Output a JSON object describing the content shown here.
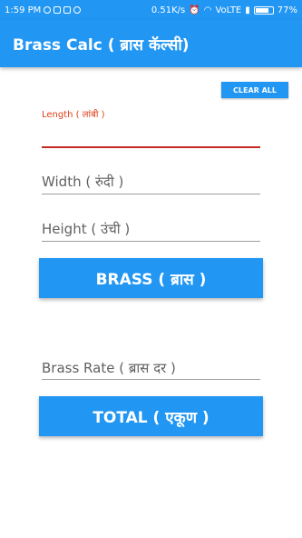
{
  "status_bar": {
    "time": "1:59 PM",
    "speed": "0.51K/s",
    "network": "VoLTE",
    "battery": "77%",
    "battery_level": 0.77
  },
  "app_bar": {
    "title": "Brass Calc ( ब्रास कॅल्सी)"
  },
  "clear_all_label": "CLEAR ALL",
  "length": {
    "label": "Length ( लांबी )"
  },
  "width": {
    "placeholder": "Width ( रुंदी )"
  },
  "height": {
    "placeholder": "Height ( उंची )"
  },
  "brass_button_label": "BRASS ( ब्रास )",
  "brass_rate": {
    "placeholder": "Brass Rate ( ब्रास दर )"
  },
  "total_button_label": "TOTAL ( एकूण )",
  "colors": {
    "primary": "#2196f3",
    "active_field": "#c62828",
    "label_accent": "#e0401a"
  }
}
